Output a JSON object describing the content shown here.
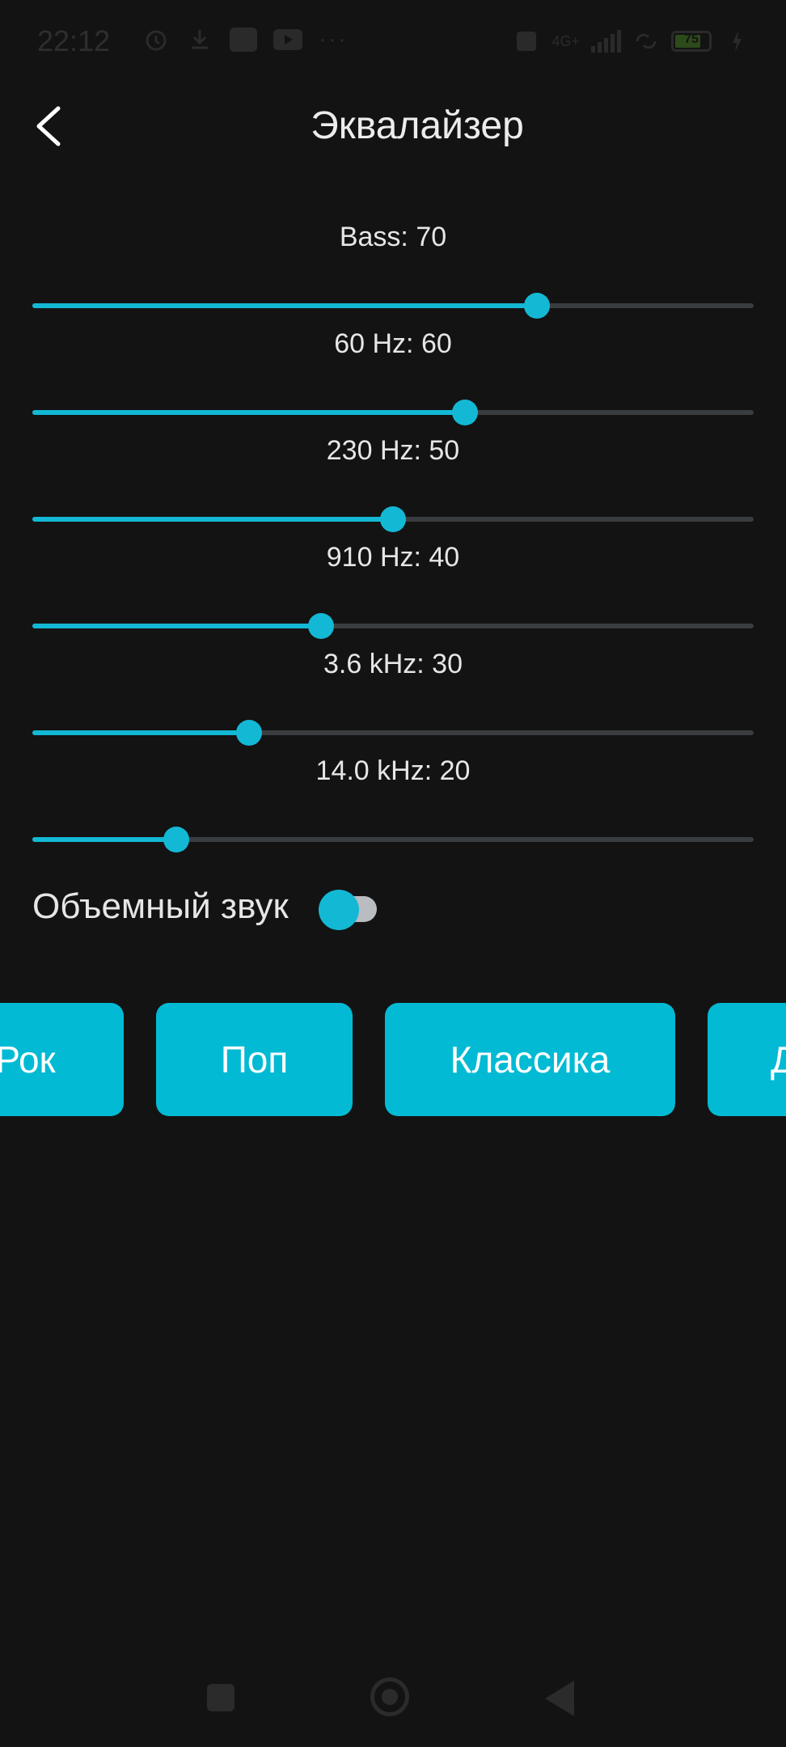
{
  "status_bar": {
    "time": "22:12",
    "network_label": "4G+",
    "battery_level": "75"
  },
  "header": {
    "title": "Эквалайзер",
    "back_icon": "chevron-left-icon"
  },
  "equalizer": {
    "bands": [
      {
        "label": "Bass: 70",
        "value": 70
      },
      {
        "label": "60 Hz: 60",
        "value": 60
      },
      {
        "label": "230 Hz: 50",
        "value": 50
      },
      {
        "label": "910 Hz: 40",
        "value": 40
      },
      {
        "label": "3.6 kHz: 30",
        "value": 30
      },
      {
        "label": "14.0 kHz: 20",
        "value": 20
      }
    ],
    "max_value": 100
  },
  "surround": {
    "label": "Объемный звук",
    "enabled": false
  },
  "presets": [
    {
      "label": "Рок"
    },
    {
      "label": "Поп"
    },
    {
      "label": "Классика"
    },
    {
      "label": "Д"
    }
  ],
  "colors": {
    "accent": "#13b8d4",
    "button": "#02bad4",
    "background": "#131313"
  }
}
